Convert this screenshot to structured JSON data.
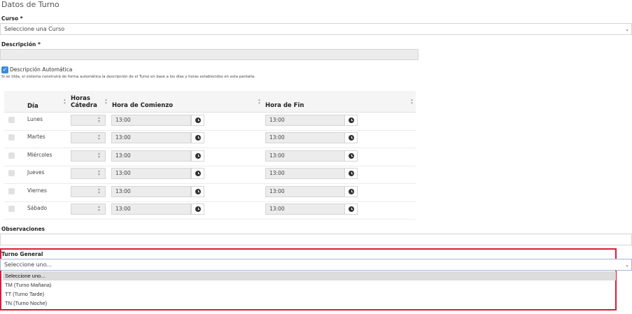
{
  "section_title": "Datos de Turno",
  "curso": {
    "label": "Curso *",
    "selected": "Seleccione una Curso"
  },
  "descripcion": {
    "label": "Descripción *",
    "value": ""
  },
  "auto_desc": {
    "checked": true,
    "label": "Descripción Automática",
    "hint": "Si se tilda, el sistema construirá de forma automática la descripción de el Turno en base a los días y horas establecidos en esta pantalla."
  },
  "table": {
    "headers": {
      "dia": "Día",
      "horas_line1": "Horas",
      "horas_line2": "Cátedra",
      "hora_comienzo": "Hora de Comienzo",
      "hora_fin": "Hora de Fin"
    },
    "rows": [
      {
        "day": "Lunes",
        "start": "13:00",
        "end": "13:00"
      },
      {
        "day": "Martes",
        "start": "13:00",
        "end": "13:00"
      },
      {
        "day": "Miércoles",
        "start": "13:00",
        "end": "13:00"
      },
      {
        "day": "Jueves",
        "start": "13:00",
        "end": "13:00"
      },
      {
        "day": "Viernes",
        "start": "13:00",
        "end": "13:00"
      },
      {
        "day": "Sábado",
        "start": "13:00",
        "end": "13:00"
      }
    ]
  },
  "observaciones": {
    "label": "Observaciones",
    "value": ""
  },
  "turno_general": {
    "label": "Turno General",
    "selected": "Seleccione uno...",
    "options": [
      "Seleccione uno...",
      "TM (Turno Mañana)",
      "TT (Turno Tarde)",
      "TN (Turno Noche)"
    ]
  },
  "colors": {
    "accent": "#3a8cd8",
    "highlight": "#e0183a"
  }
}
